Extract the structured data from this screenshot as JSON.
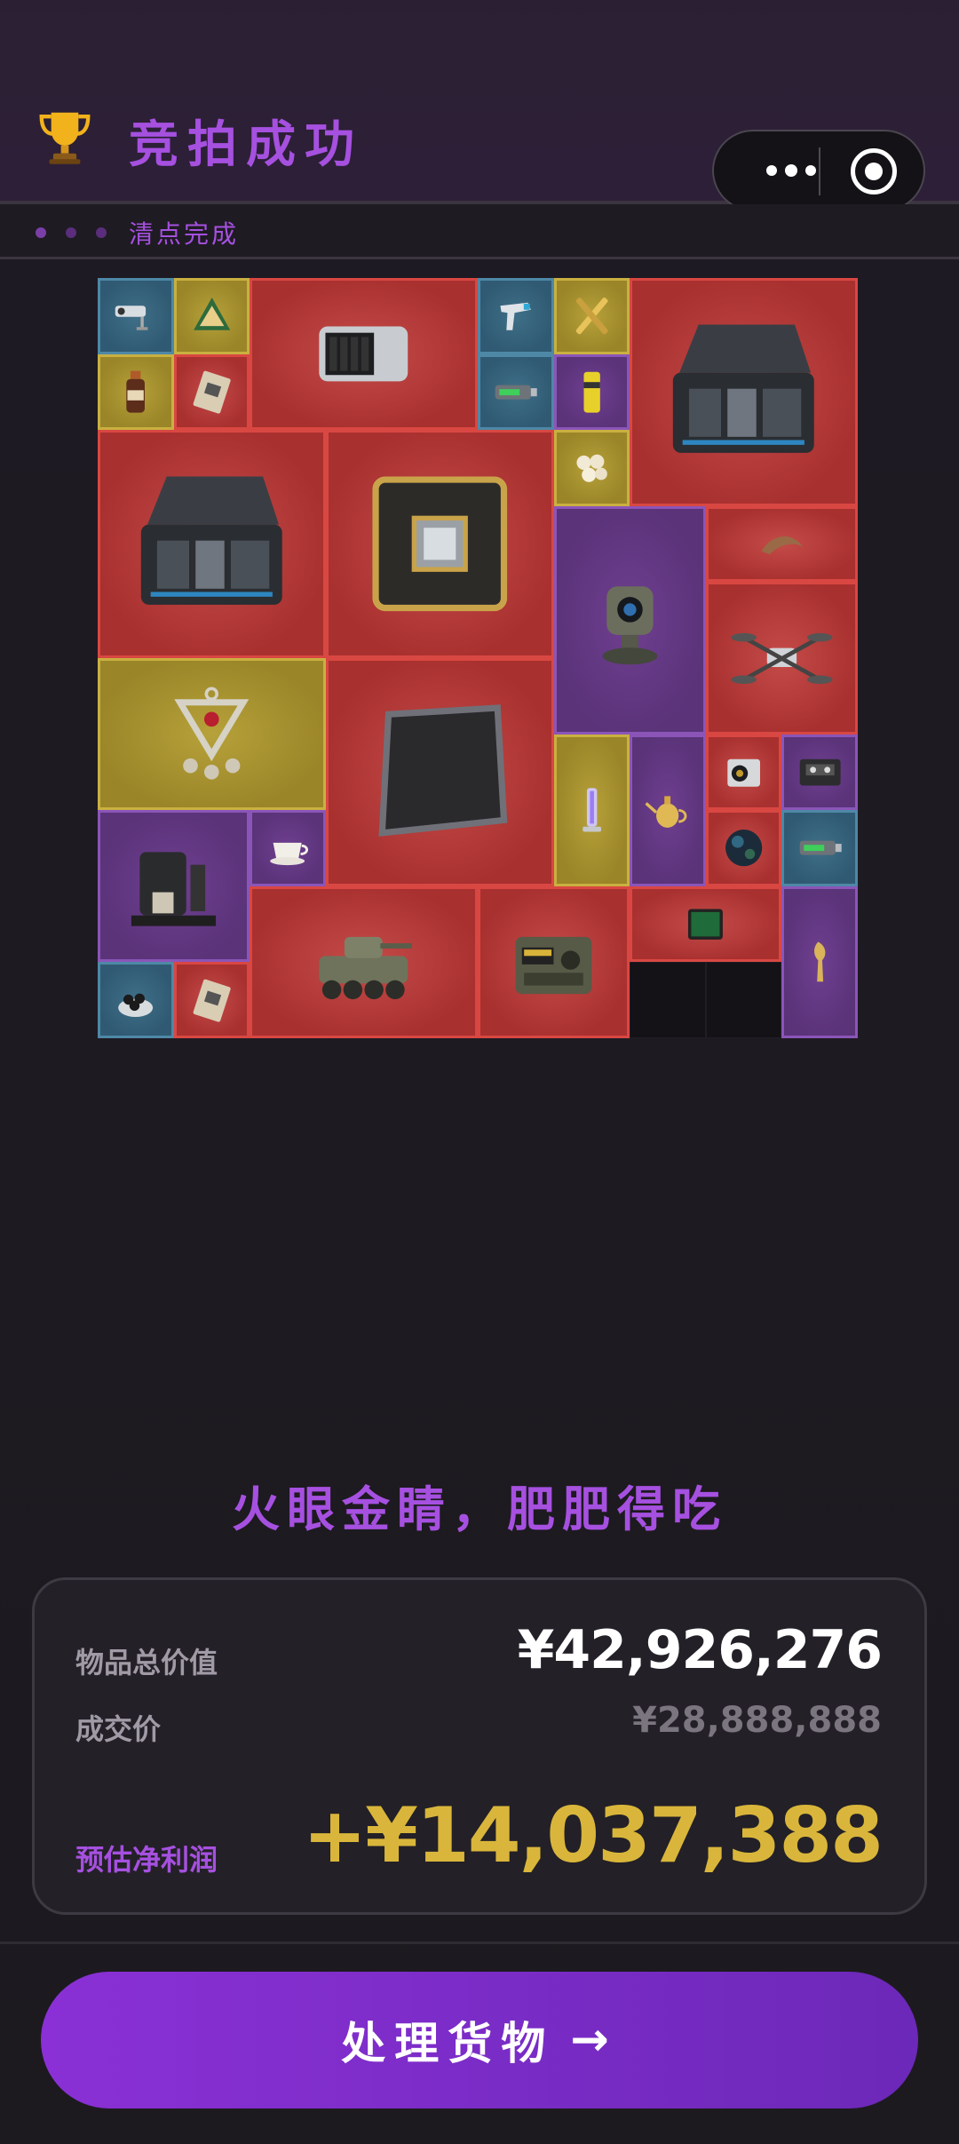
{
  "header": {
    "title": "竞拍成功",
    "trophy_icon": "trophy-icon",
    "status_label": "清点完成",
    "capsule": {
      "more_icon": "more-dots-icon",
      "close_icon": "target-circle-icon"
    }
  },
  "grid": {
    "items": [
      {
        "name": "security-camera",
        "rarity": "blue"
      },
      {
        "name": "cheese-snack",
        "rarity": "gold"
      },
      {
        "name": "nas-drive-bay",
        "rarity": "red"
      },
      {
        "name": "thermometer-gun",
        "rarity": "blue"
      },
      {
        "name": "fountain-pen",
        "rarity": "gold"
      },
      {
        "name": "server-case",
        "rarity": "red"
      },
      {
        "name": "sauce-bottle",
        "rarity": "gold"
      },
      {
        "name": "circuit-module",
        "rarity": "red"
      },
      {
        "name": "usb-stick",
        "rarity": "blue"
      },
      {
        "name": "energy-can",
        "rarity": "purple"
      },
      {
        "name": "server-case",
        "rarity": "red"
      },
      {
        "name": "cpu-board",
        "rarity": "red"
      },
      {
        "name": "pearls",
        "rarity": "gold"
      },
      {
        "name": "turret-camera",
        "rarity": "purple"
      },
      {
        "name": "claw-horn",
        "rarity": "red"
      },
      {
        "name": "quadcopter-drone",
        "rarity": "red"
      },
      {
        "name": "jewel-pendant",
        "rarity": "gold"
      },
      {
        "name": "carbon-plate",
        "rarity": "red"
      },
      {
        "name": "uv-tube",
        "rarity": "gold"
      },
      {
        "name": "gold-teapot",
        "rarity": "purple"
      },
      {
        "name": "camera-module",
        "rarity": "red"
      },
      {
        "name": "cassette-tape",
        "rarity": "purple"
      },
      {
        "name": "coffee-machine",
        "rarity": "purple"
      },
      {
        "name": "teacup",
        "rarity": "purple"
      },
      {
        "name": "dark-orb",
        "rarity": "red"
      },
      {
        "name": "usb-stick",
        "rarity": "blue"
      },
      {
        "name": "armored-vehicle",
        "rarity": "red"
      },
      {
        "name": "field-radio",
        "rarity": "red"
      },
      {
        "name": "green-tablet",
        "rarity": "red"
      },
      {
        "name": "gold-horn-statue",
        "rarity": "purple"
      },
      {
        "name": "lens-kit",
        "rarity": "blue"
      },
      {
        "name": "circuit-module",
        "rarity": "red"
      }
    ]
  },
  "slogan": "火眼金睛，肥肥得吃",
  "summary": {
    "total_label": "物品总价值",
    "total_value": "¥42,926,276",
    "deal_label": "成交价",
    "deal_value": "¥28,888,888",
    "profit_label": "预估净利润",
    "profit_value": "+¥14,037,388"
  },
  "cta": {
    "label": "处理货物",
    "arrow": "→"
  },
  "colors": {
    "accent": "#a650e0",
    "gold": "#d9b63b",
    "rarity_red": "#d94742",
    "rarity_purple": "#8b55b8",
    "rarity_gold": "#c9b040",
    "rarity_blue": "#4e88a6"
  }
}
